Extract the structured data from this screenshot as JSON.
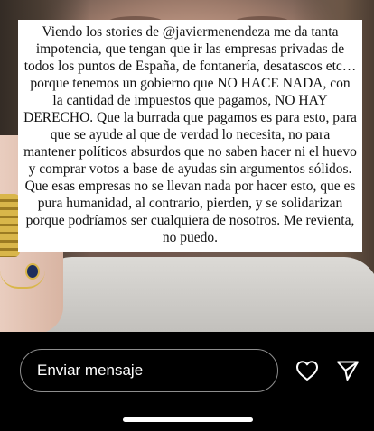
{
  "story": {
    "text_before_mention": "Viendo los stories de ",
    "mention": "@javiermenendeza",
    "text_after_mention": " me da tanta impotencia, que tengan que ir las empresas privadas de todos los puntos de España, de fontanería, desatascos etc… porque tenemos un gobierno que NO HACE NADA, con la cantidad de impuestos que pagamos, NO HAY DERECHO. Que la burrada que pagamos es para esto, para que se ayude al que de verdad lo necesita, no para mantener políticos absurdos que no saben hacer ni el huevo y comprar votos a base de ayudas sin argumentos sólidos. Que esas empresas no se llevan nada por hacer esto, que es pura humanidad, al contrario, pierden, y se solidarizan porque podríamos ser cualquiera de nosotros. Me revienta, no puedo."
  },
  "reply_bar": {
    "placeholder": "Enviar mensaje",
    "like_icon": "heart-icon",
    "send_icon": "paper-plane-icon"
  },
  "colors": {
    "background": "#000000",
    "text_box": "#ffffff",
    "input_border": "#8e8e8e"
  }
}
